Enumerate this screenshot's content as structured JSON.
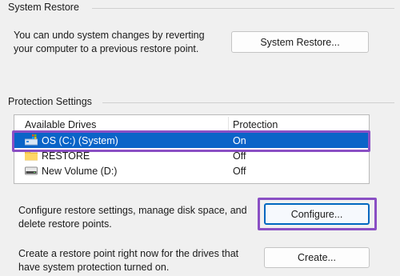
{
  "system_restore": {
    "title": "System Restore",
    "description_line1": "You can undo system changes by reverting",
    "description_line2": "your computer to a previous restore point.",
    "button_label": "System Restore..."
  },
  "protection_settings": {
    "title": "Protection Settings",
    "columns": {
      "drives": "Available Drives",
      "protection": "Protection"
    },
    "drives": [
      {
        "name": "OS (C:) (System)",
        "protection": "On",
        "icon": "system-drive-icon",
        "selected": true
      },
      {
        "name": "RESTORE",
        "protection": "Off",
        "icon": "folder-icon",
        "selected": false
      },
      {
        "name": "New Volume (D:)",
        "protection": "Off",
        "icon": "drive-icon",
        "selected": false
      }
    ],
    "configure_text_line1": "Configure restore settings, manage disk space, and",
    "configure_text_line2": "delete restore points.",
    "configure_button": "Configure...",
    "create_text_line1": "Create a restore point right now for the drives that",
    "create_text_line2": "have system protection turned on.",
    "create_button": "Create..."
  },
  "colors": {
    "selection": "#0a64c8",
    "highlight_annotation": "#8a4fc4",
    "window_background": "#f0f0f0"
  }
}
